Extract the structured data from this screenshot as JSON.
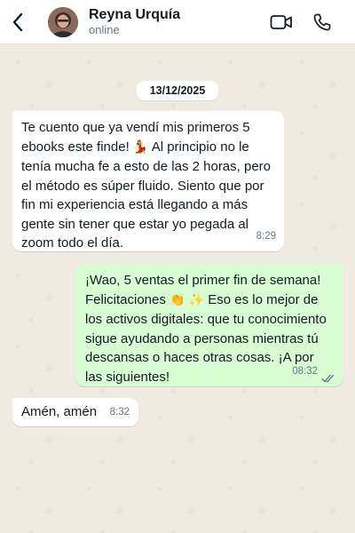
{
  "header": {
    "contact_name": "Reyna Urquía",
    "status": "online",
    "icons": {
      "back": "chevron-left-icon",
      "video": "video-camera-icon",
      "call": "phone-icon"
    }
  },
  "chat": {
    "date_separator": "13/12/2025",
    "messages": [
      {
        "direction": "incoming",
        "text_a": "Te cuento que ya vendí mis primeros 5 ebooks este finde! ",
        "emoji_a": "💃",
        "text_b": " Al principio no le tenía mucha fe a esto de las 2 horas, pero el método es súper fluido. Siento que por fin mi experiencia está llegando a más gente sin tener que estar yo pegada al zoom todo el día.",
        "time": "8:29"
      },
      {
        "direction": "outgoing",
        "text_a": "¡Wao, 5 ventas el primer fin de semana! Felicitaciones ",
        "emoji_a": "👏",
        "emoji_b": "✨",
        "text_b": "  Eso es lo mejor de los activos digitales: que tu conocimiento sigue ayudando a personas mientras tú descansas o haces otras cosas. ¡A por las siguientes!",
        "time": "08:32",
        "status": "read"
      },
      {
        "direction": "incoming",
        "text": "Amén, amén",
        "time": "8:32"
      }
    ]
  },
  "colors": {
    "chat_background": "#efeae2",
    "incoming_bubble": "#ffffff",
    "outgoing_bubble": "#d9fdd3",
    "read_ticks": "#667781"
  }
}
